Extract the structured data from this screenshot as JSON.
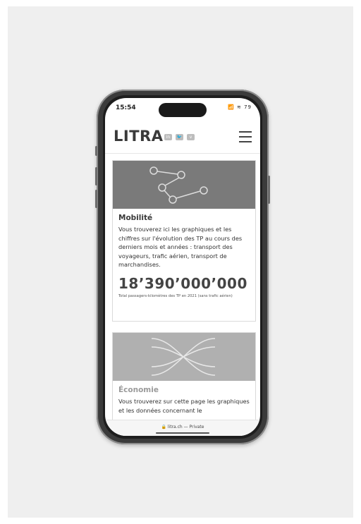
{
  "status": {
    "time": "15:54",
    "icons": "📶 ≋ 79"
  },
  "header": {
    "logo": "LITRA",
    "social": [
      "in",
      "🐦",
      "v"
    ]
  },
  "cards": [
    {
      "title": "Mobilité",
      "text": "Vous trouverez ici les graphiques et les chiffres sur l'évolution des TP au cours des derniers mois et années : transport des voyageurs, trafic aérien, transport de marchandises.",
      "number": "18’390’000’000",
      "caption": "Total passagers-kilomètres des TP en 2021 (sans trafic aérien)",
      "icon": "network-route-icon"
    },
    {
      "title": "Économie",
      "text": "Vous trouverez sur cette page les graphiques et les données concernant le",
      "icon": "crossing-tracks-icon"
    }
  ],
  "address_bar": {
    "text": "🔒 litra.ch — Private"
  },
  "colors": {
    "background": "#efefef",
    "frame": "#3b3b3b",
    "card_image_1": "#7a7a7a",
    "card_image_2": "#b0b0b0"
  }
}
